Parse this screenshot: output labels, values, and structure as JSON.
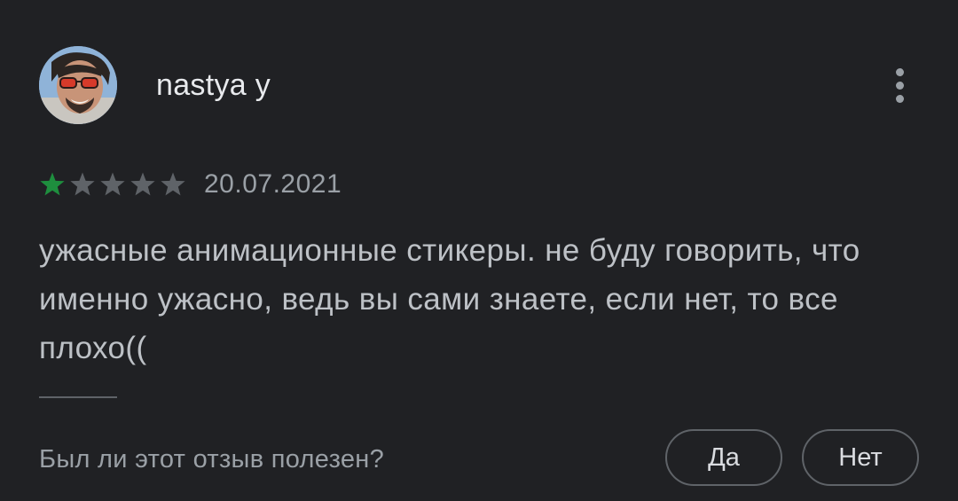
{
  "review": {
    "author": {
      "name": "nastya y",
      "avatar_icon": "user-photo-avatar"
    },
    "menu_icon": "more-vert-icon",
    "rating": {
      "value": 1,
      "max": 5,
      "filled_color": "#1e8e3e",
      "empty_color": "#5f6368"
    },
    "date": "20.07.2021",
    "text": "ужасные анимационные стикеры. не буду говорить, что именно ужасно, ведь вы сами знаете, если нет, то все плохо((",
    "helpful": {
      "question": "Был ли этот отзыв полезен?",
      "yes_label": "Да",
      "no_label": "Нет"
    }
  },
  "theme": {
    "background": "#202124",
    "text_primary": "#e8eaed",
    "text_secondary": "#9aa0a6",
    "border": "#5f6368"
  }
}
